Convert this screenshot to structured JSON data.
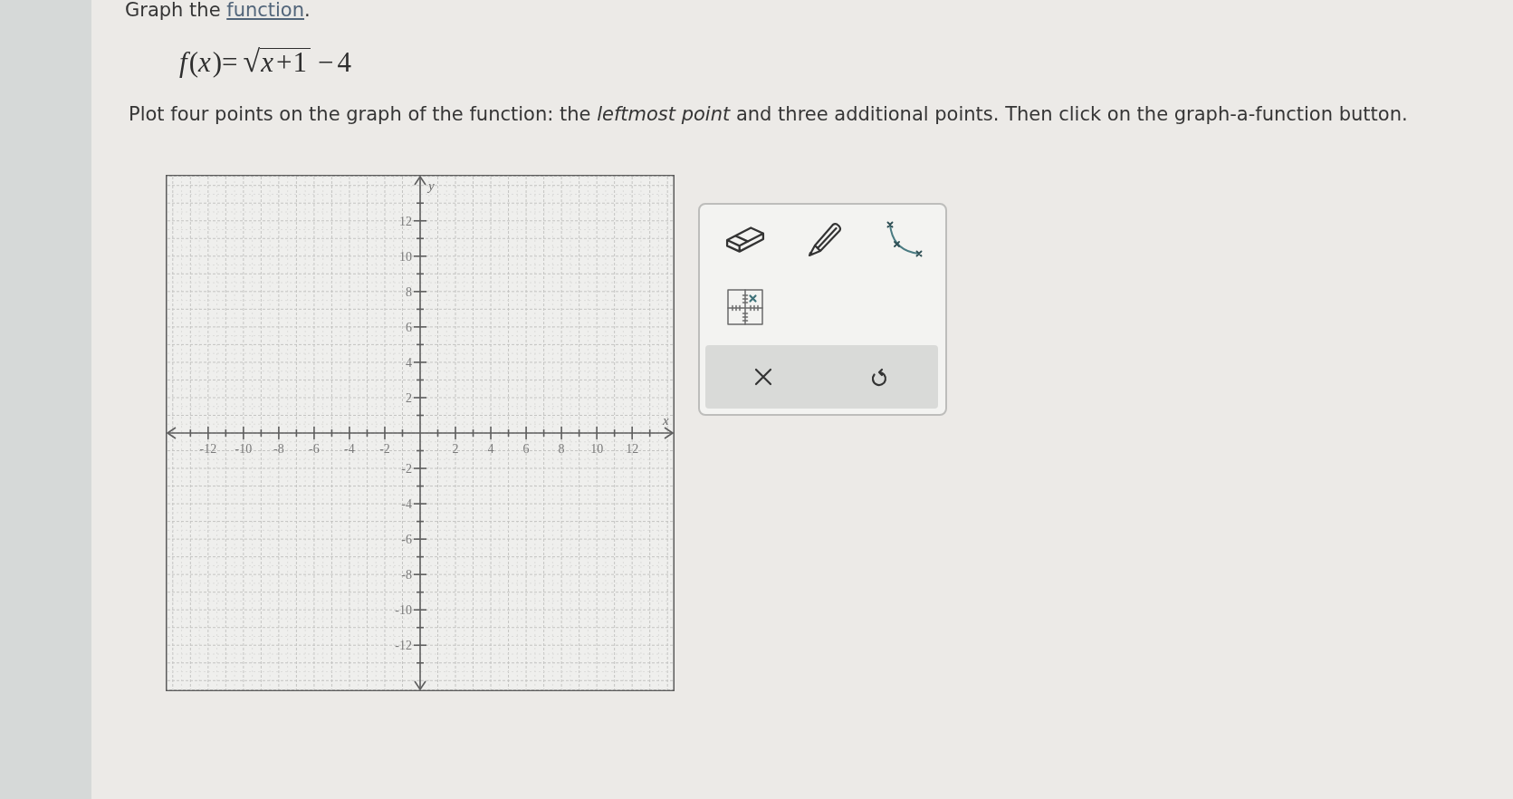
{
  "heading": {
    "before": "Graph the ",
    "link": "function",
    "after": "."
  },
  "formula": {
    "left": "*f*(*x*)=",
    "root_sign": "√",
    "radicand": "*x*+1",
    "right": "−4"
  },
  "instructions": "Plot four points on the graph of the function: the *leftmost point* and three additional points. Then click on the graph-a-function button.",
  "graph": {
    "chart_data": {
      "type": "scatter",
      "xlabel": "x",
      "ylabel": "y",
      "xlim": [
        -14.4,
        14.4
      ],
      "ylim": [
        -14.6,
        14.6
      ],
      "xticks": [
        -12,
        -10,
        -8,
        -6,
        -4,
        -2,
        2,
        4,
        6,
        8,
        10,
        12
      ],
      "yticks": [
        -12,
        -10,
        -8,
        -6,
        -4,
        -2,
        2,
        4,
        6,
        8,
        10,
        12
      ],
      "grid": true
    }
  },
  "tools": [
    {
      "kind": "eraser"
    },
    {
      "kind": "pencil"
    },
    {
      "kind": "function"
    },
    {
      "kind": "point"
    }
  ],
  "actions": [
    {
      "kind": "clear"
    },
    {
      "kind": "undo"
    }
  ]
}
